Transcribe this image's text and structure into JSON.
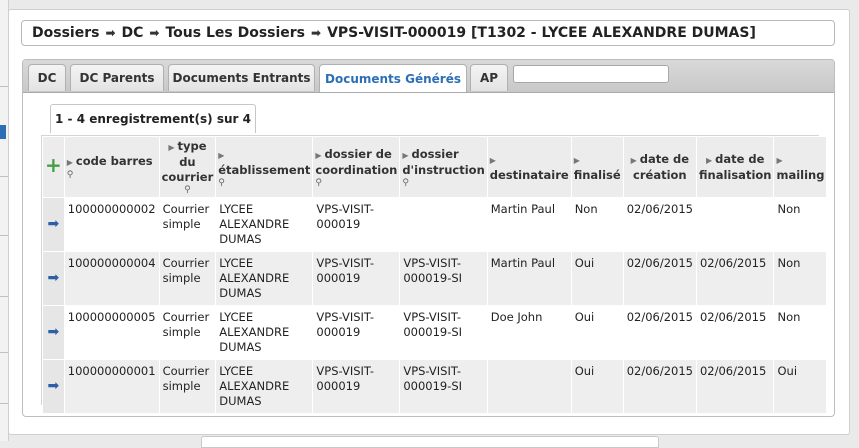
{
  "breadcrumb": {
    "items": [
      "Dossiers",
      "DC",
      "Tous Les Dossiers",
      "VPS-VISIT-000019 [T1302 - LYCEE ALEXANDRE DUMAS]"
    ]
  },
  "tabs": [
    {
      "label": "DC",
      "active": false
    },
    {
      "label": "DC Parents",
      "active": false
    },
    {
      "label": "Documents Entrants",
      "active": false
    },
    {
      "label": "Documents Générés",
      "active": true
    },
    {
      "label": "AP",
      "active": false
    }
  ],
  "tab_search": {
    "value": ""
  },
  "record_count": "1 - 4 enregistrement(s) sur 4",
  "table": {
    "add_icon": "plus-icon",
    "headers": {
      "code_barres": "code barres",
      "type_courrier": "type du courrier",
      "etablissement": "établissement",
      "dossier_coordination": "dossier de coordination",
      "dossier_instruction": "dossier d'instruction",
      "destinataire": "destinataire",
      "finalise": "finalisé",
      "date_creation": "date de création",
      "date_finalisation": "date de finalisation",
      "mailing": "mailing"
    },
    "rows": [
      {
        "code_barres": "100000000002",
        "type_courrier": "Courrier simple",
        "etablissement": "LYCEE ALEXANDRE DUMAS",
        "dossier_coordination": "VPS-VISIT-000019",
        "dossier_instruction": "",
        "destinataire": "Martin Paul",
        "finalise": "Non",
        "date_creation": "02/06/2015",
        "date_finalisation": "",
        "mailing": "Non"
      },
      {
        "code_barres": "100000000004",
        "type_courrier": "Courrier simple",
        "etablissement": "LYCEE ALEXANDRE DUMAS",
        "dossier_coordination": "VPS-VISIT-000019",
        "dossier_instruction": "VPS-VISIT-000019-SI",
        "destinataire": "Martin Paul",
        "finalise": "Oui",
        "date_creation": "02/06/2015",
        "date_finalisation": "02/06/2015",
        "mailing": "Non"
      },
      {
        "code_barres": "100000000005",
        "type_courrier": "Courrier simple",
        "etablissement": "LYCEE ALEXANDRE DUMAS",
        "dossier_coordination": "VPS-VISIT-000019",
        "dossier_instruction": "VPS-VISIT-000019-SI",
        "destinataire": "Doe John",
        "finalise": "Oui",
        "date_creation": "02/06/2015",
        "date_finalisation": "02/06/2015",
        "mailing": "Non"
      },
      {
        "code_barres": "100000000001",
        "type_courrier": "Courrier simple",
        "etablissement": "LYCEE ALEXANDRE DUMAS",
        "dossier_coordination": "VPS-VISIT-000019",
        "dossier_instruction": "VPS-VISIT-000019-SI",
        "destinataire": "",
        "finalise": "Oui",
        "date_creation": "02/06/2015",
        "date_finalisation": "02/06/2015",
        "mailing": "Oui"
      }
    ]
  },
  "colors": {
    "accent": "#2c6fb6",
    "add": "#43a047",
    "row_arrow": "#2d5fa8"
  }
}
